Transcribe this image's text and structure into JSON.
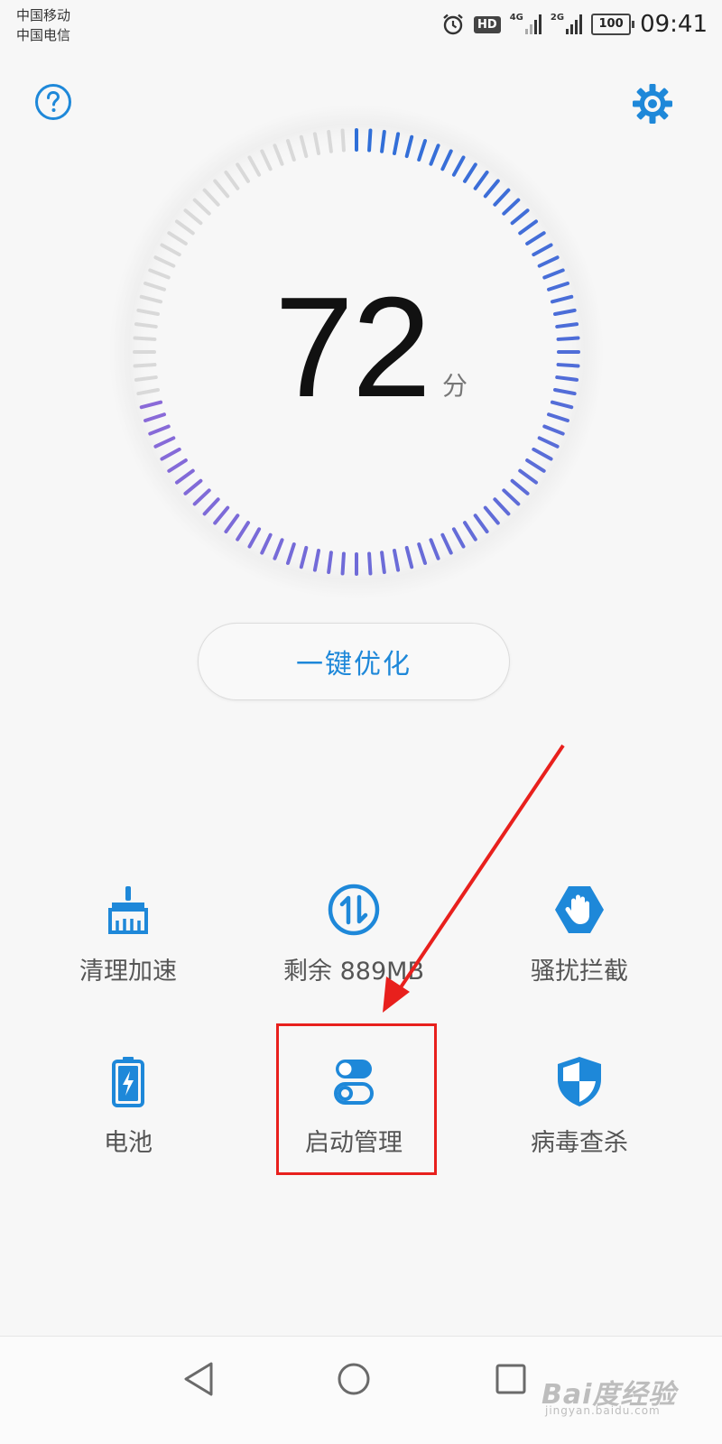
{
  "status_bar": {
    "carrier_1": "中国移动",
    "carrier_2": "中国电信",
    "alarm_icon": "alarm-clock-icon",
    "hd_badge": "HD",
    "network_1": "4G",
    "network_2": "2G",
    "battery": "100",
    "time": "09:41"
  },
  "header": {
    "help_icon": "question-circle-icon",
    "settings_icon": "gear-icon"
  },
  "score": {
    "value": "72",
    "unit": "分",
    "accent_start": "#2f6fd8",
    "accent_end": "#8a6ad8",
    "track_color": "#d9d9d9"
  },
  "optimize_button": {
    "label": "一键优化"
  },
  "features": [
    {
      "label": "清理加速",
      "icon": "broom-icon"
    },
    {
      "label": "剩余 889MB",
      "icon": "memory-arrows-icon"
    },
    {
      "label": "骚扰拦截",
      "icon": "hand-stop-icon"
    },
    {
      "label": "电池",
      "icon": "battery-charging-icon"
    },
    {
      "label": "启动管理",
      "icon": "toggle-switch-icon"
    },
    {
      "label": "病毒查杀",
      "icon": "shield-icon"
    }
  ],
  "accent_color": "#1e88d9",
  "annotation": {
    "color": "#e8201d",
    "highlight": "启动管理"
  },
  "nav_bar": {
    "back_icon": "triangle-back-icon",
    "home_icon": "circle-home-icon",
    "recent_icon": "square-recent-icon"
  },
  "watermark": {
    "main": "Bai度经验",
    "sub": "jingyan.baidu.com"
  }
}
